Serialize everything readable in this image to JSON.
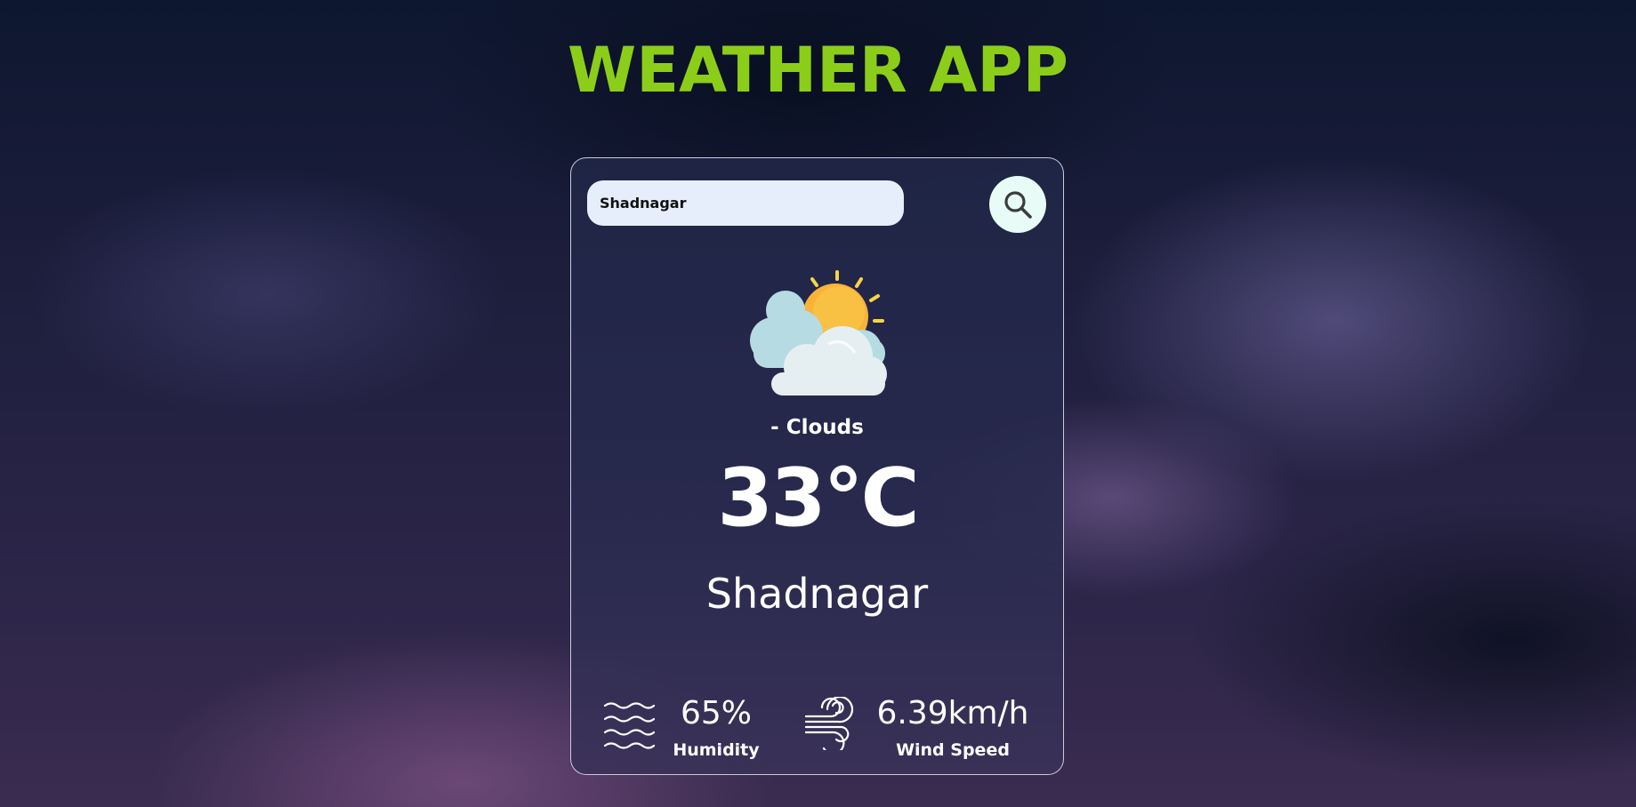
{
  "app": {
    "title": "WEATHER APP",
    "accent_color": "#8ccd1a"
  },
  "search": {
    "value": "Shadnagar",
    "button_icon": "search-icon"
  },
  "weather": {
    "icon": "sun-behind-clouds-icon",
    "condition": "- Clouds",
    "temperature": "33°C",
    "city": "Shadnagar"
  },
  "details": {
    "humidity": {
      "icon": "humidity-waves-icon",
      "value": "65%",
      "label": "Humidity"
    },
    "wind": {
      "icon": "wind-icon",
      "value": "6.39km/h",
      "label": "Wind Speed"
    }
  }
}
